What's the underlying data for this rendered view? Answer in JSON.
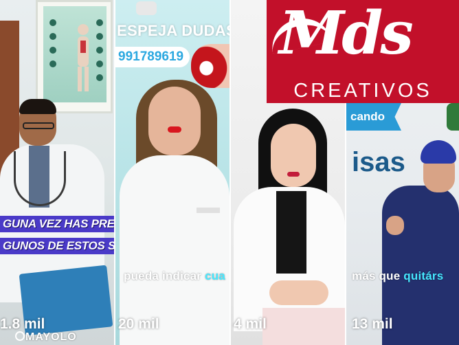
{
  "tiles": [
    {
      "caption_lines": [
        "GUNA VEZ HAS PRESEN",
        "GUNOS DE ESTOS SÍNTO"
      ],
      "views": "1.8 mil",
      "watermark": "MAYOLO"
    },
    {
      "banner": "ESPEJA DUDAS",
      "phone": "991789619",
      "subtitle_plain": "pueda indicar ",
      "subtitle_highlight": "cua",
      "views": "20 mil"
    },
    {
      "views": "4 mil"
    },
    {
      "wall_tag": "cando",
      "wall_text": "isas",
      "subtitle_plain": "más que ",
      "subtitle_highlight": "quitárs",
      "views": "13 mil"
    }
  ],
  "logo": {
    "script": "Mds",
    "sub": "CREATIVOS",
    "bg_color": "#c2102a"
  },
  "colors": {
    "caption_bg": "#4a3ac8",
    "phone_text": "#2ba8e0",
    "highlight": "#46e8ff"
  }
}
